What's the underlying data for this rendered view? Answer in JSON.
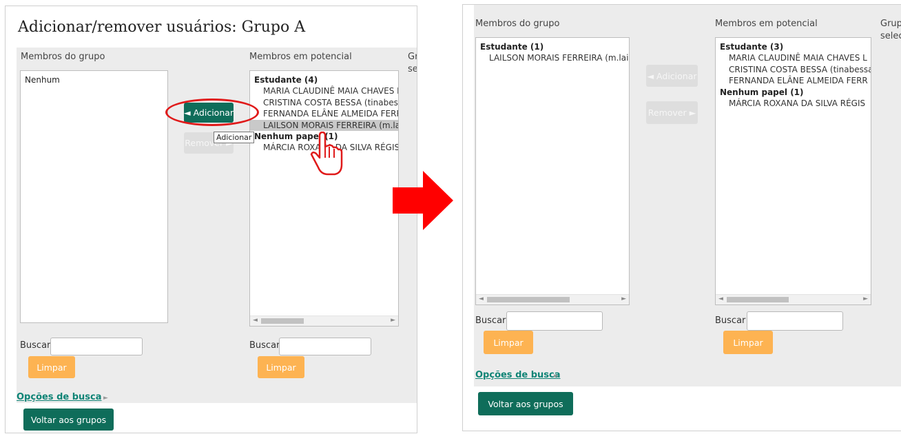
{
  "before": {
    "title": "Adicionar/remover usuários: Grupo A",
    "members_label": "Membros do grupo",
    "potential_label": "Membros em potencial",
    "selected_label_clipped": "Gr",
    "selected_label_clipped_line2": "se",
    "members_options": [
      "Nenhum"
    ],
    "potential_groups": [
      {
        "label": "Estudante (4)",
        "options": [
          "MARIA CLAUDINÊ MAIA CHAVES L",
          "CRISTINA COSTA BESSA (tinabessa",
          "FERNANDA ELÂNE ALMEIDA FERR",
          "LAILSON MORAIS FERREIRA (m.lail"
        ]
      },
      {
        "label": "Nenhum papel (1)",
        "options": [
          "MÁRCIA ROXANA DA SILVA RÉGIS"
        ]
      }
    ],
    "add_button": "◄ Adicionar",
    "remove_button": "Remover ►",
    "tooltip": "Adicionar",
    "search_label": "Buscar",
    "clear_button": "Limpar",
    "search_options": "Opções de busca",
    "back_button": "Voltar aos grupos"
  },
  "after": {
    "members_label": "Membros do grupo",
    "potential_label": "Membros em potencial",
    "selected_label_clipped": "Grup",
    "selected_label_clipped_line2": "selec",
    "members_groups": [
      {
        "label": "Estudante (1)",
        "options": [
          "LAILSON MORAIS FERREIRA (m.lai"
        ]
      }
    ],
    "potential_groups": [
      {
        "label": "Estudante (3)",
        "options": [
          "MARIA CLAUDINÊ MAIA CHAVES L",
          "CRISTINA COSTA BESSA (tinabessa",
          "FERNANDA ELÂNE ALMEIDA FERR"
        ]
      },
      {
        "label": "Nenhum papel (1)",
        "options": [
          "MÁRCIA ROXANA DA SILVA RÉGIS"
        ]
      }
    ],
    "add_button": "◄ Adicionar",
    "remove_button": "Remover ►",
    "search_label": "Buscar",
    "clear_button": "Limpar",
    "search_options": "Opções de busca",
    "back_button": "Voltar aos grupos"
  },
  "colors": {
    "primary": "#0f6d5a",
    "orange": "#fdb352",
    "annotation_red": "#e01a1a",
    "link": "#0f8476"
  }
}
